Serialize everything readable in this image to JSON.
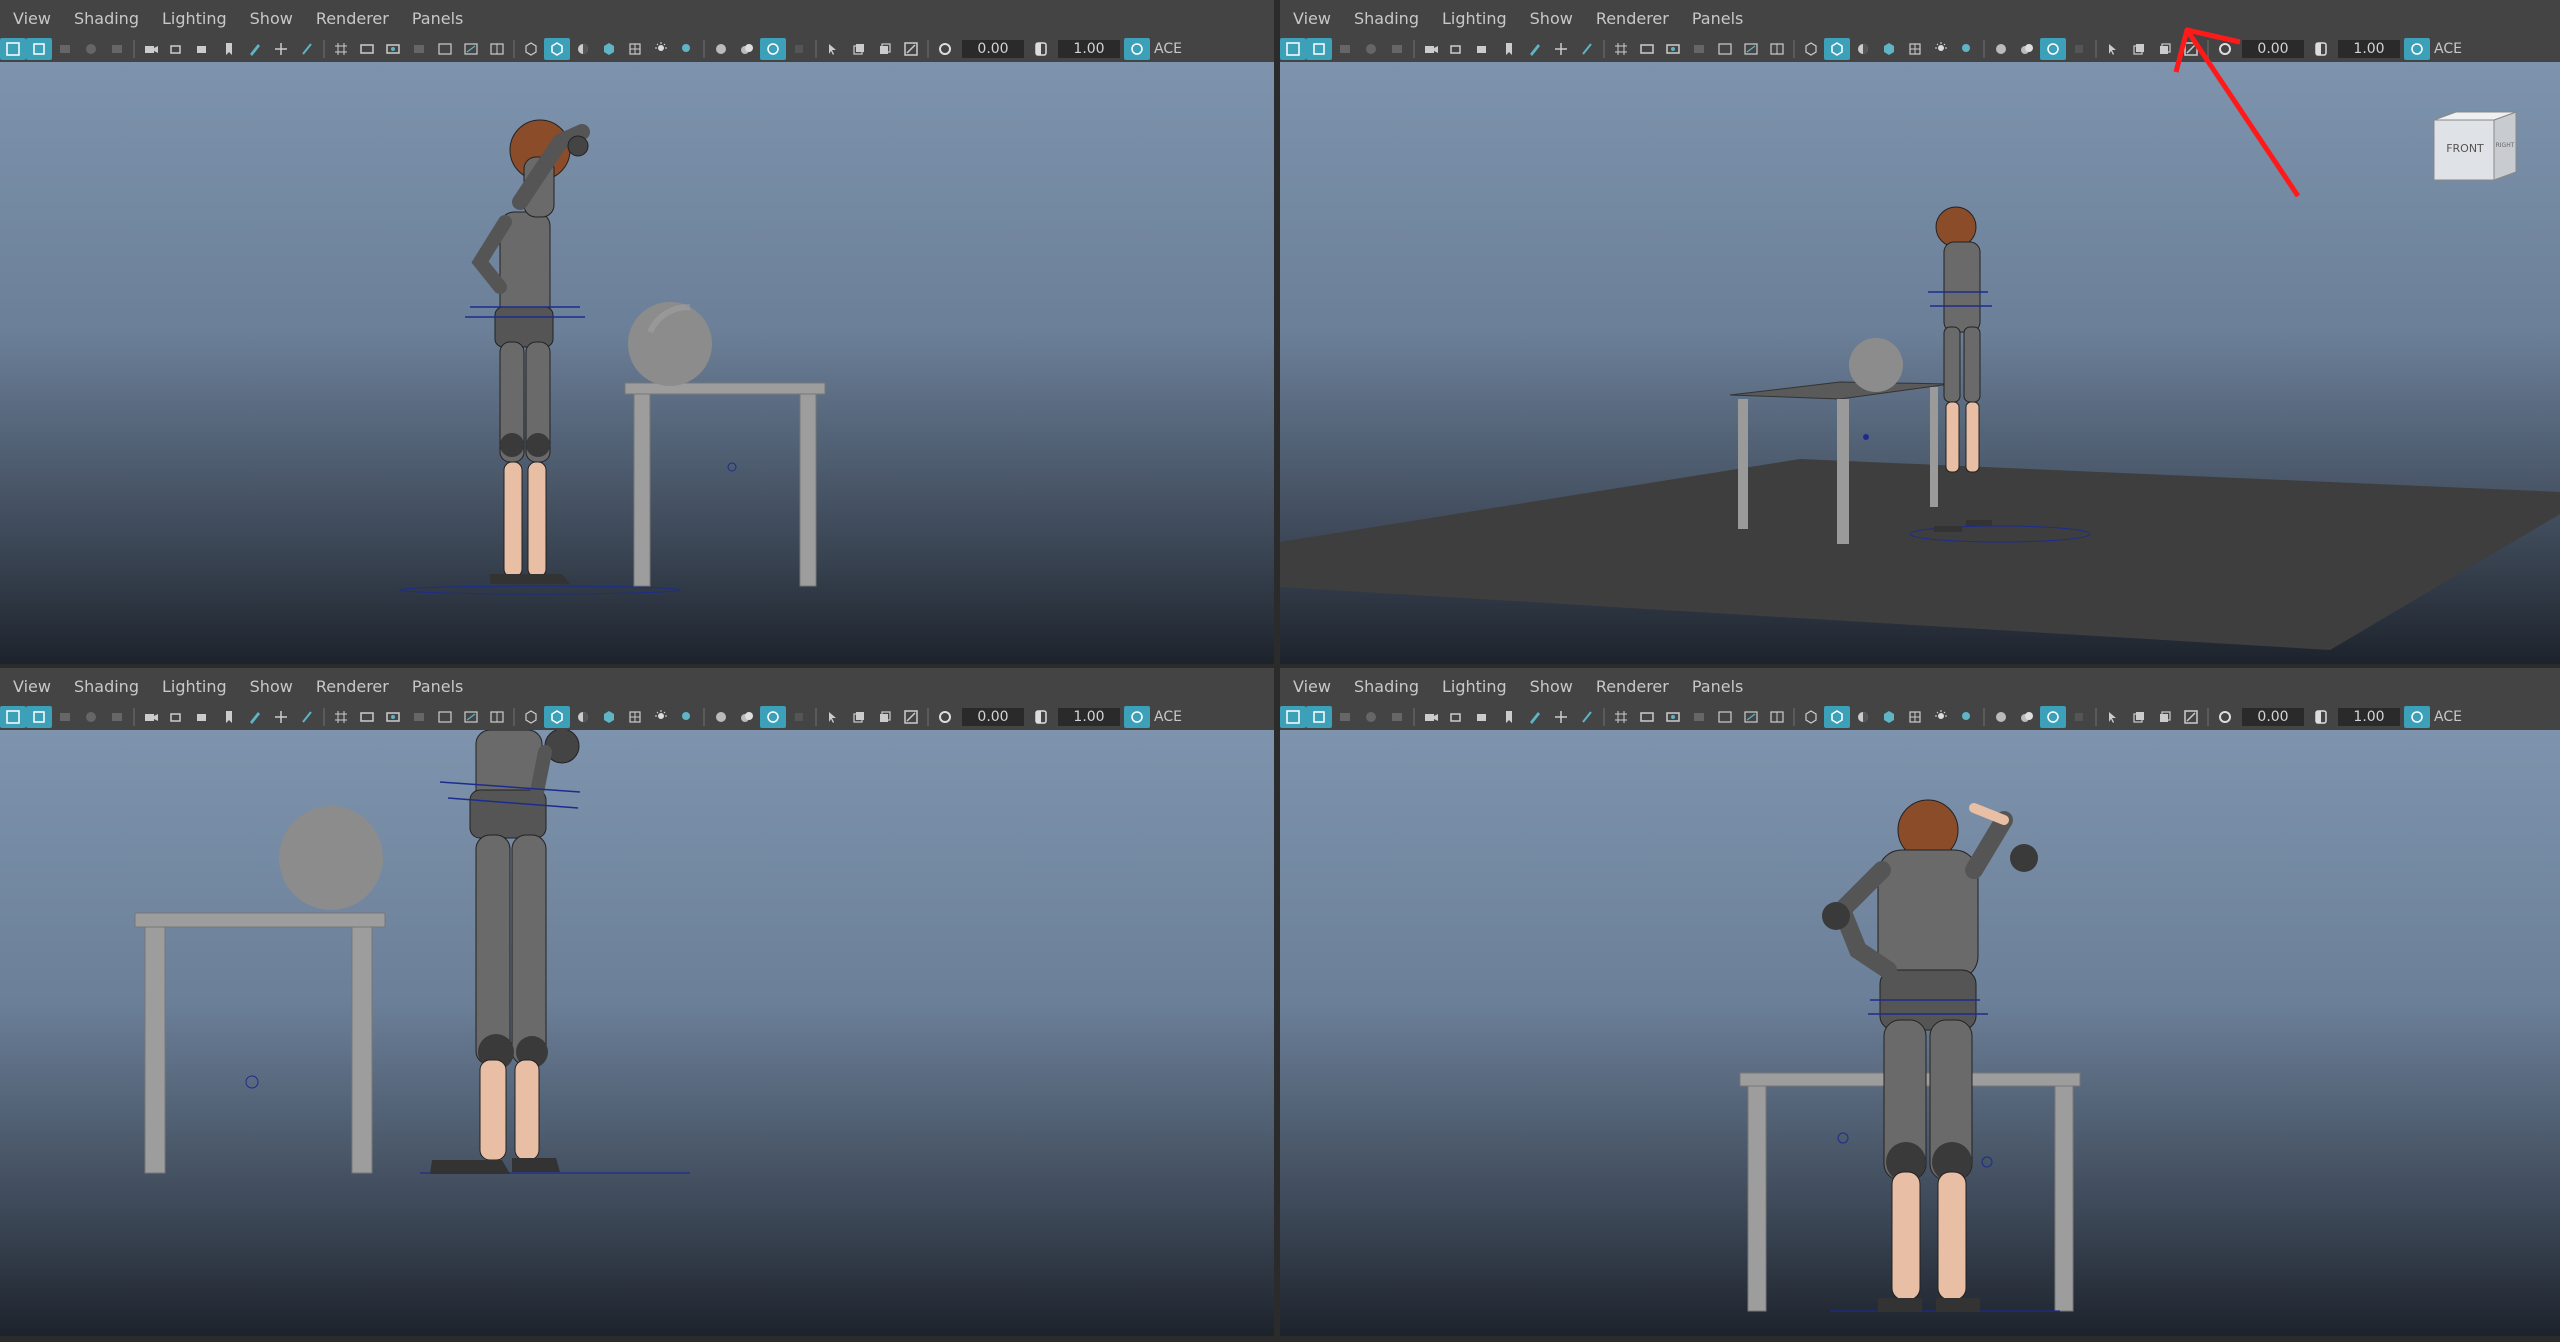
{
  "menus": [
    "View",
    "Shading",
    "Lighting",
    "Show",
    "Renderer",
    "Panels"
  ],
  "toolbar": {
    "exposure": "0.00",
    "gamma": "1.00",
    "color_mgmt": "ACE"
  },
  "viewcube": {
    "front_label": "FRONT",
    "side_label": "RIGHT"
  },
  "annotation": {
    "color": "#ff1a1a"
  },
  "colors": {
    "ui_bg": "#444444",
    "accent": "#3ba0b8",
    "sky_top": "#7e93ad",
    "sky_bottom": "#1d232c"
  }
}
